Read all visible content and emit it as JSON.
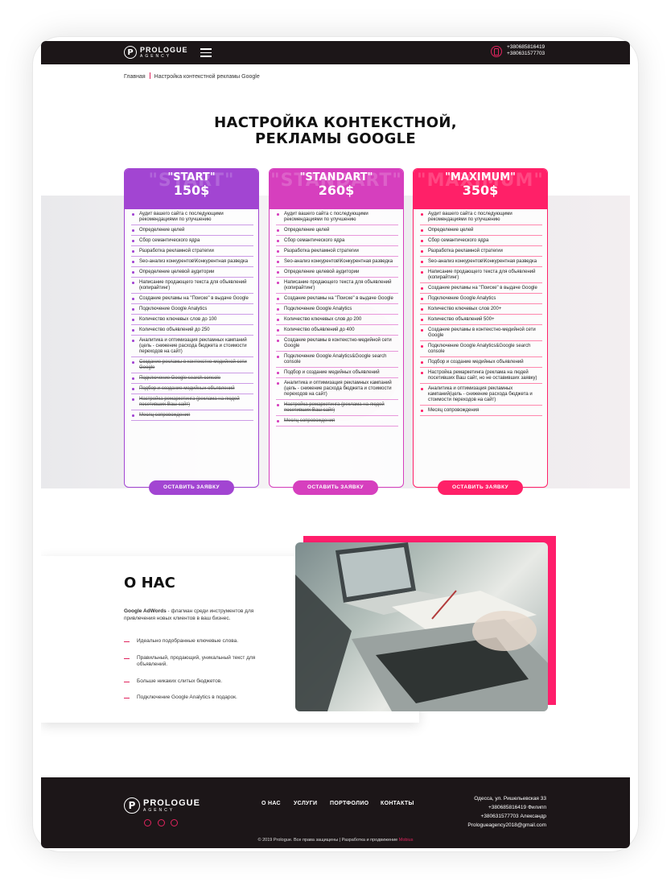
{
  "header": {
    "logo_main": "PROLOGUE",
    "logo_sub": "AGENCY",
    "logo_letter": "P",
    "phones": [
      "+380685816419",
      "+380631577703"
    ]
  },
  "breadcrumb": {
    "home": "Главная",
    "current": "Настройка контекстной рекламы Google"
  },
  "page_title_line1": "НАСТРОЙКА КОНТЕКСТНОЙ,",
  "page_title_line2": "РЕКЛАМЫ GOOGLE",
  "plans": [
    {
      "name": "\"START\"",
      "price": "150$",
      "color": "#a245d2",
      "button": "ОСТАВИТЬ ЗАЯВКУ",
      "features": [
        {
          "text": "Аудит вашего сайта с последующими рекомендациями по улучшению",
          "off": false
        },
        {
          "text": "Определение целей",
          "off": false
        },
        {
          "text": "Сбор семантического ядра",
          "off": false
        },
        {
          "text": "Разработка рекламной стратегии",
          "off": false
        },
        {
          "text": "Seo-анализ конкурентов\\Конкурентная разведка",
          "off": false
        },
        {
          "text": "Определение целевой аудитории",
          "off": false
        },
        {
          "text": "Написание продающего текста для объявлений (копирайтинг)",
          "off": false
        },
        {
          "text": "Создание рекламы на \"Поиске\" в выдаче Google",
          "off": false
        },
        {
          "text": "Подключение Google Analytics",
          "off": false
        },
        {
          "text": "Количество ключевых слов до 100",
          "off": false
        },
        {
          "text": "Количество объявлений до 250",
          "off": false
        },
        {
          "text": "Аналитика и оптимизация рекламных кампаний (цель - снижение расхода бюджета и стоимости переходов на сайт)",
          "off": false
        },
        {
          "text": "Создание рекламы в контекстно-медийной сети Google",
          "off": true
        },
        {
          "text": "Подключение Google search console",
          "off": true
        },
        {
          "text": "Подбор и создание медийных объявлений",
          "off": true
        },
        {
          "text": "Настройка ремаркетинга (реклама на людей посетивших Ваш сайт)",
          "off": true
        },
        {
          "text": "Месяц сопровождения",
          "off": true
        }
      ]
    },
    {
      "name": "\"STANDART\"",
      "price": "260$",
      "color": "#d63fbe",
      "button": "ОСТАВИТЬ ЗАЯВКУ",
      "features": [
        {
          "text": "Аудит вашего сайта с последующими рекомендациями по улучшению",
          "off": false
        },
        {
          "text": "Определение целей",
          "off": false
        },
        {
          "text": "Сбор семантического ядра",
          "off": false
        },
        {
          "text": "Разработка рекламной стратегии",
          "off": false
        },
        {
          "text": "Seo-анализ конкурентов\\Конкурентная разведка",
          "off": false
        },
        {
          "text": "Определение целевой аудитории",
          "off": false
        },
        {
          "text": "Написание продающего текста для объявлений (копирайтинг)",
          "off": false
        },
        {
          "text": "Создание рекламы на \"Поиске\" в выдаче Google",
          "off": false
        },
        {
          "text": "Подключение Google Analytics",
          "off": false
        },
        {
          "text": "Количество ключевых слов до 200",
          "off": false
        },
        {
          "text": "Количество объявлений до 400",
          "off": false
        },
        {
          "text": "Создание рекламы в контекстно-медийной сети Google",
          "off": false
        },
        {
          "text": "Подключение Google Analytics&Google search console",
          "off": false
        },
        {
          "text": "Подбор и создание медийных объявлений",
          "off": false
        },
        {
          "text": "Аналитика и оптимизация рекламных кампаний (цель - снижение расхода бюджета и стоимости переходов на сайт)",
          "off": false
        },
        {
          "text": "Настройка ремаркетинга (реклама на людей посетивших Ваш сайт)",
          "off": true
        },
        {
          "text": "Месяц сопровождения",
          "off": true
        }
      ]
    },
    {
      "name": "\"MAXIMUM\"",
      "price": "350$",
      "color": "#ff2068",
      "button": "ОСТАВИТЬ ЗАЯВКУ",
      "features": [
        {
          "text": "Аудит вашего сайта с последующими рекомендациями по улучшению",
          "off": false
        },
        {
          "text": "Определение целей",
          "off": false
        },
        {
          "text": "Сбор семантического ядра",
          "off": false
        },
        {
          "text": "Разработка рекламной стратегии",
          "off": false
        },
        {
          "text": "Seo-анализ конкурентов\\Конкурентная разведка",
          "off": false
        },
        {
          "text": "Написание продающего текста для объявлений (копирайтинг)",
          "off": false
        },
        {
          "text": "Создание рекламы на \"Поиске\" в выдаче Google",
          "off": false
        },
        {
          "text": "Подключение Google Analytics",
          "off": false
        },
        {
          "text": "Количество ключевых слов 200+",
          "off": false
        },
        {
          "text": "Количество объявлений 500+",
          "off": false
        },
        {
          "text": "Создание рекламы в контекстно-медийной сети Google",
          "off": false
        },
        {
          "text": "Подключение Google Analytics&Google search console",
          "off": false
        },
        {
          "text": "Подбор и создание медийных объявлений",
          "off": false
        },
        {
          "text": "Настройка ремаркетинга (реклама на людей посетивших Ваш сайт, но не оставивших заявку)",
          "off": false
        },
        {
          "text": "Аналитика и оптимизация рекламных кампаний(цель - снижение расхода бюджета и стоимости переходов на сайт)",
          "off": false
        },
        {
          "text": "Месяц сопровождения",
          "off": false
        }
      ]
    }
  ],
  "about": {
    "title": "О НАС",
    "intro_bold": "Google AdWords",
    "intro_rest": " - флагман среди инструментов для привлечения новых клиентов в ваш бизнес.",
    "items": [
      "Идеально подобранные ключевые слова.",
      "Правильный, продающий, уникальный текст для объявлений.",
      "Больше никаких слитых бюджетов.",
      "Подключение Google Analytics в подарок."
    ]
  },
  "footer": {
    "nav": [
      "О НАС",
      "УСЛУГИ",
      "ПОРТФОЛИО",
      "КОНТАКТЫ"
    ],
    "address": "Одесса, ул. Ришельевская 33",
    "phone1": "+380685816419  Филипп",
    "phone2": "+380631577703   Александр",
    "email": "Prologueagency2018@gmail.com",
    "copyright": "© 2019 Prologue. Все права защищены | Разработка и продвижение ",
    "developer": "Mobius"
  },
  "colors": {
    "accent": "#e0245e",
    "dark": "#1c1618"
  }
}
